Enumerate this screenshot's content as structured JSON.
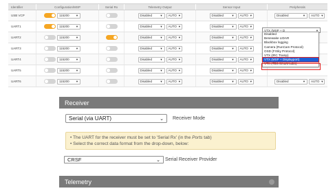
{
  "ports_table": {
    "headers": [
      "Identifier",
      "Configuration/MSP",
      "Serial Rx",
      "Telemetry Output",
      "Sensor Input",
      "Peripherals"
    ],
    "rows": [
      {
        "id": "USB VCP",
        "msp": true,
        "baud": "115200",
        "serial_rx": false,
        "tel": "Disabled",
        "tel_auto": "AUTO",
        "sen": "Disabled",
        "sen_auto": "AUTO",
        "per": "Disabled",
        "per_auto": "AUTO"
      },
      {
        "id": "UART1",
        "msp": true,
        "baud": "115200",
        "serial_rx": false,
        "tel": "Disabled",
        "tel_auto": "AUTO",
        "sen": "Disabled",
        "sen_auto": "AUTO",
        "per": "VTX (MSP + D",
        "per_auto": ""
      },
      {
        "id": "UART2",
        "msp": false,
        "baud": "115200",
        "serial_rx": true,
        "tel": "Disabled",
        "tel_auto": "AUTO",
        "sen": "Disabled",
        "sen_auto": "AUTO",
        "per": "",
        "per_auto": ""
      },
      {
        "id": "UART3",
        "msp": false,
        "baud": "115200",
        "serial_rx": false,
        "tel": "Disabled",
        "tel_auto": "AUTO",
        "sen": "Disabled",
        "sen_auto": "AUTO",
        "per": "",
        "per_auto": ""
      },
      {
        "id": "UART4",
        "msp": false,
        "baud": "115200",
        "serial_rx": false,
        "tel": "Disabled",
        "tel_auto": "AUTO",
        "sen": "Disabled",
        "sen_auto": "AUTO",
        "per": "",
        "per_auto": ""
      },
      {
        "id": "UART5",
        "msp": false,
        "baud": "115200",
        "serial_rx": false,
        "tel": "Disabled",
        "tel_auto": "AUTO",
        "sen": "Disabled",
        "sen_auto": "AUTO",
        "per": "",
        "per_auto": ""
      },
      {
        "id": "UART6",
        "msp": false,
        "baud": "115200",
        "serial_rx": false,
        "tel": "Disabled",
        "tel_auto": "AUTO",
        "sen": "Disabled",
        "sen_auto": "AUTO",
        "per": "Disabled",
        "per_auto": "AUTO"
      }
    ]
  },
  "peripherals_dropdown": {
    "current": "VTX (MSP + D",
    "options": [
      "Disabled",
      "Benewake LIDAR",
      "Blackbox logging",
      "Camera (RunCam Protocol)",
      "OSD (FrSky Protocol)",
      "VTX (IRC Tramp)",
      "VTX (MSP + Displayport)",
      "VTX (TBS SmartAudio)"
    ],
    "highlighted": "VTX (MSP + Displayport)"
  },
  "receiver": {
    "title": "Receiver",
    "mode_value": "Serial (via UART)",
    "mode_label": "Receiver Mode",
    "note_line1_pre": "• The UART for the receiver must be set to 'Serial Rx' (in the ",
    "note_line1_link": "Ports",
    "note_line1_post": " tab)",
    "note_line2": "• Select the correct data format from the drop-down, below:",
    "provider_value": "CRSF",
    "provider_label": "Serial Receiver Provider"
  },
  "telemetry": {
    "title": "Telemetry"
  },
  "colors": {
    "toggle_on": "#f5a623",
    "highlight": "#1e5fd6",
    "highlight_border": "#e02020",
    "note_bg": "#fbf1cf",
    "panel_header": "#7a7a7a"
  },
  "icons": [
    "chevron-down-icon",
    "help-icon"
  ]
}
